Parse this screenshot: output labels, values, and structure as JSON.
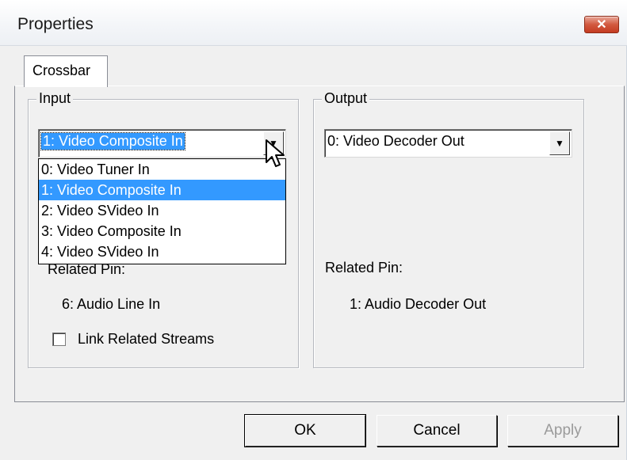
{
  "window": {
    "title": "Properties",
    "close_label": "✕"
  },
  "tabs": [
    {
      "label": "Crossbar"
    }
  ],
  "input": {
    "group_label": "Input",
    "selected": "1: Video Composite In",
    "options": [
      "0: Video Tuner In",
      "1: Video Composite In",
      "2: Video SVideo In",
      "3: Video Composite In",
      "4: Video SVideo In"
    ],
    "related_pin_label": "Related Pin:",
    "related_pin_value": "6: Audio Line In",
    "link_checkbox_label": "Link Related Streams"
  },
  "output": {
    "group_label": "Output",
    "selected": "0: Video Decoder Out",
    "related_pin_label": "Related Pin:",
    "related_pin_value": "1: Audio Decoder Out"
  },
  "buttons": {
    "ok": "OK",
    "cancel": "Cancel",
    "apply": "Apply"
  },
  "icons": {
    "close": "close-icon",
    "arrow": "chevron-down-icon",
    "cursor": "mouse-pointer-icon"
  }
}
